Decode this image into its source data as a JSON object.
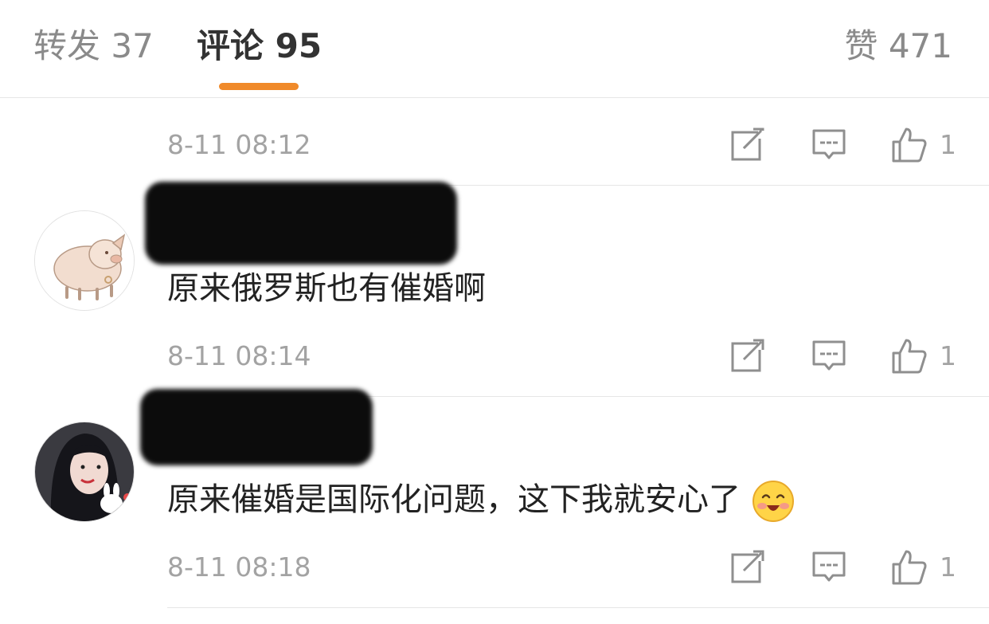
{
  "tabs": {
    "repost": "转发 37",
    "comment": "评论 95",
    "like": "赞 471"
  },
  "colors": {
    "accent": "#f08a2a",
    "meta_text": "#a3a3a3",
    "divider": "#e6e6e6"
  },
  "comments": [
    {
      "time": "8-11 08:12",
      "like_count": "1"
    },
    {
      "text": "原来俄罗斯也有催婚啊",
      "time": "8-11 08:14",
      "like_count": "1",
      "avatar": "pig-avatar"
    },
    {
      "text": "原来催婚是国际化问题，这下我就安心了",
      "emoji": "happy-blush-emoji",
      "time": "8-11 08:18",
      "like_count": "1",
      "avatar": "girl-avatar"
    }
  ]
}
